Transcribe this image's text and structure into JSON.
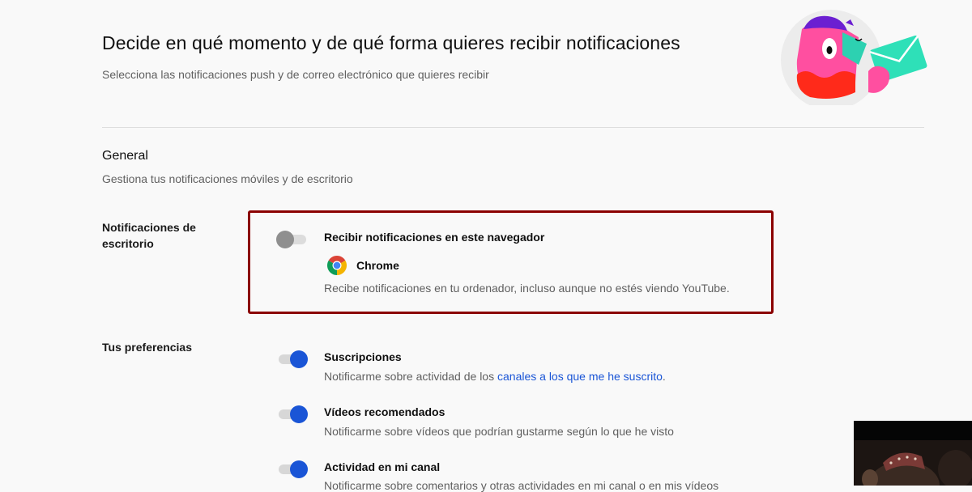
{
  "header": {
    "title": "Decide en qué momento y de qué forma quieres recibir notificaciones",
    "subtitle": "Selecciona las notificaciones push y de correo electrónico que quieres recibir"
  },
  "general": {
    "title": "General",
    "subtitle": "Gestiona tus notificaciones móviles y de escritorio",
    "desktop_label": "Notificaciones de escritorio",
    "desktop_toggle_title": "Recibir notificaciones en este navegador",
    "browser_name": "Chrome",
    "desktop_desc": "Recibe notificaciones en tu ordenador, incluso aunque no estés viendo YouTube."
  },
  "preferences": {
    "label": "Tus preferencias",
    "items": [
      {
        "title": "Suscripciones",
        "desc_prefix": "Notificarme sobre actividad de los ",
        "desc_link": "canales a los que me he suscrito",
        "desc_suffix": "."
      },
      {
        "title": "Vídeos recomendados",
        "desc": "Notificarme sobre vídeos que podrían gustarme según lo que he visto"
      },
      {
        "title": "Actividad en mi canal",
        "desc": "Notificarme sobre comentarios y otras actividades en mi canal o en mis vídeos"
      }
    ]
  },
  "colors": {
    "accent": "#1a55d6",
    "highlight_border": "#8b0000",
    "toggle_off": "#8f8f8f"
  }
}
